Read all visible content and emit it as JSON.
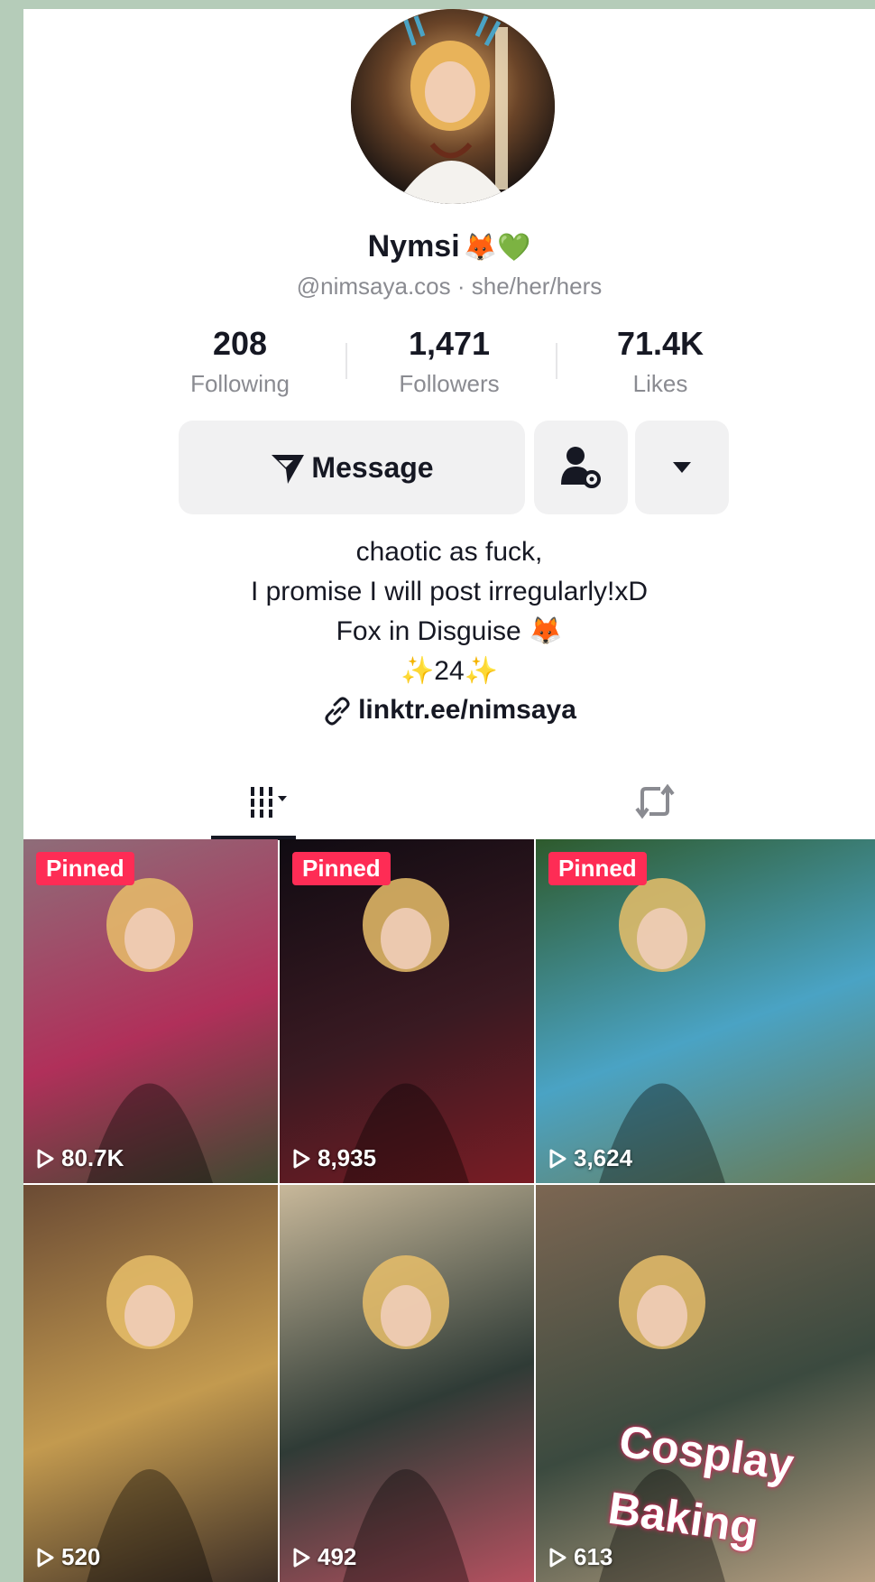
{
  "profile": {
    "display_name": "Nymsi",
    "name_emojis": "🦊💚",
    "handle_line": "@nimsaya.cos · she/her/hers"
  },
  "stats": [
    {
      "value": "208",
      "label": "Following"
    },
    {
      "value": "1,471",
      "label": "Followers"
    },
    {
      "value": "71.4K",
      "label": "Likes"
    }
  ],
  "actions": {
    "message_label": "Message",
    "add_friend_icon": "person-gear-icon",
    "more_icon": "caret-down-icon"
  },
  "bio": {
    "line1": "chaotic as fuck,",
    "line2": "I promise I will post irregularly!xD",
    "line3": "Fox in Disguise 🦊",
    "line4": "✨24✨",
    "link": "linktr.ee/nimsaya"
  },
  "tabs": {
    "videos_icon": "grid-icon",
    "reposts_icon": "repost-icon"
  },
  "videos": [
    {
      "pinned": "Pinned",
      "views": "80.7K",
      "colors": [
        "#8e6d79",
        "#b0305a",
        "#3e4a30"
      ]
    },
    {
      "pinned": "Pinned",
      "views": "8,935",
      "colors": [
        "#100b12",
        "#3a1a22",
        "#7a1c24"
      ]
    },
    {
      "pinned": "Pinned",
      "views": "3,624",
      "colors": [
        "#2e5a2c",
        "#4aa3c4",
        "#6a7a52"
      ]
    },
    {
      "pinned": "",
      "views": "520",
      "colors": [
        "#6b4b34",
        "#c39a4f",
        "#3d2f26"
      ]
    },
    {
      "pinned": "",
      "views": "492",
      "colors": [
        "#c8b89a",
        "#2f3b36",
        "#b55160"
      ]
    },
    {
      "pinned": "",
      "views": "613",
      "colors": [
        "#7c6652",
        "#3b4a3f",
        "#b7a082"
      ],
      "overlay_line1": "Cosplay",
      "overlay_line2": "Baking"
    }
  ],
  "colors": {
    "accent": "#fe2c55",
    "text": "#161823",
    "muted": "#8a8b91",
    "button_bg": "#f1f1f2"
  }
}
